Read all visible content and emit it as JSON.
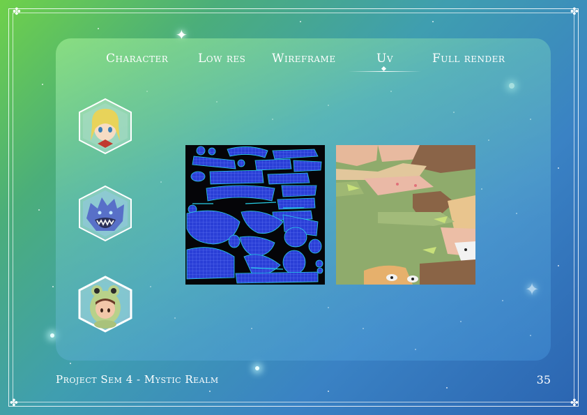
{
  "nav": {
    "items": [
      {
        "label": "Character"
      },
      {
        "label": "Low res"
      },
      {
        "label": "Wireframe"
      },
      {
        "label": "Uv"
      },
      {
        "label": "Full render"
      }
    ],
    "active_index": 3
  },
  "thumbnails": [
    {
      "subject": "blonde-anime-girl-head"
    },
    {
      "subject": "blue-monster-head"
    },
    {
      "subject": "frog-hood-character-head"
    }
  ],
  "footer": {
    "title": "Project Sem 4 - Mystic Realm",
    "page_number": "35"
  },
  "colors": {
    "accent": "#ffffff",
    "uv_island": "#2a3fd6",
    "uv_outline": "#27d0e8"
  }
}
